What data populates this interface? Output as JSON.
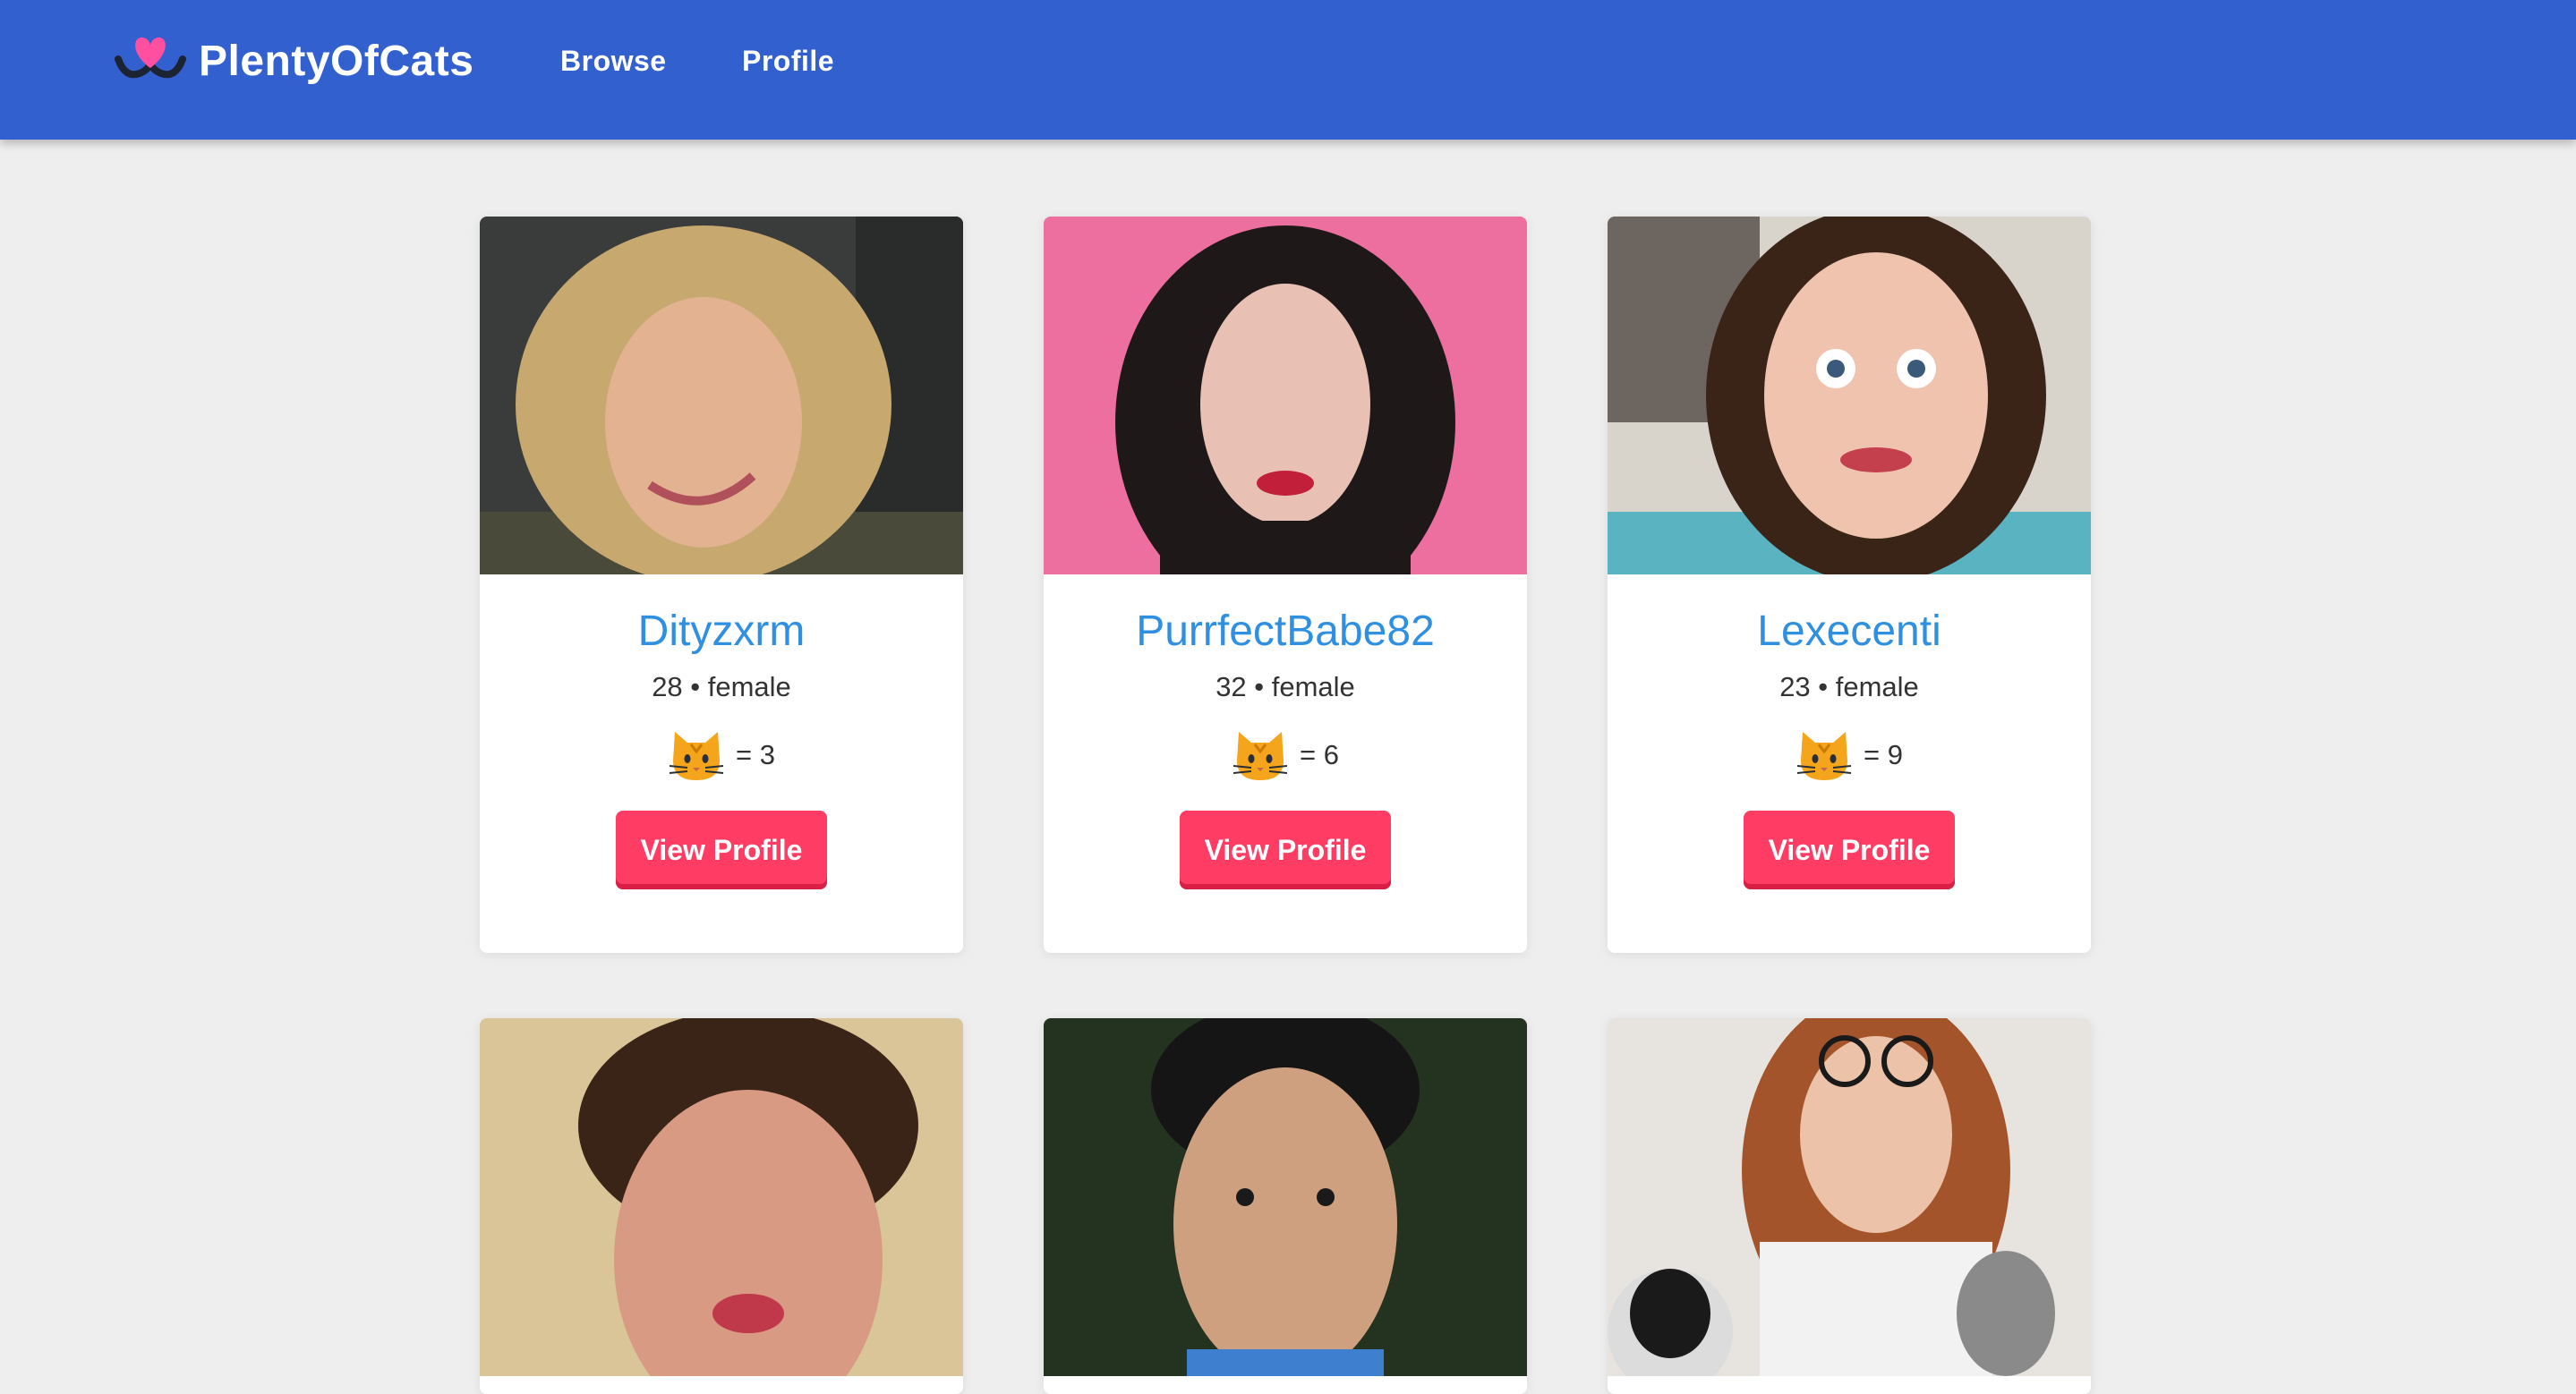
{
  "app": {
    "brand": "PlentyOfCats"
  },
  "nav": {
    "browse": "Browse",
    "profile": "Profile"
  },
  "profiles": [
    {
      "name": "Dityzxrm",
      "meta": "28 • female",
      "cats": "= 3",
      "button": "View Profile"
    },
    {
      "name": "PurrfectBabe82",
      "meta": "32 • female",
      "cats": "= 6",
      "button": "View Profile"
    },
    {
      "name": "Lexecenti",
      "meta": "23 • female",
      "cats": "= 9",
      "button": "View Profile"
    }
  ],
  "colors": {
    "navbar": "#3260cf",
    "accent": "#ff3d64",
    "name": "#2f8fe0",
    "background": "#eeeeee"
  }
}
